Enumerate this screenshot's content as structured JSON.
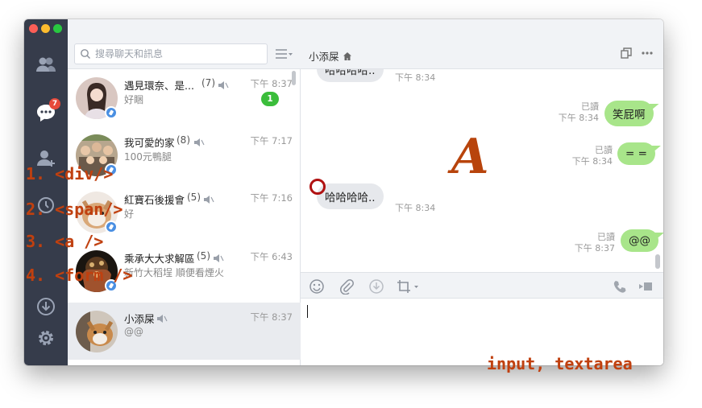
{
  "sidebar": {
    "icons": [
      "friends-icon",
      "chat-icon",
      "add-friend-icon",
      "timeline-icon",
      "download-icon",
      "settings-icon"
    ],
    "chat_badge": "7"
  },
  "search": {
    "placeholder": "搜尋聊天和訊息"
  },
  "chat_list": [
    {
      "name": "遇見環奈、是...",
      "count": "(7)",
      "time": "下午 8:37",
      "preview": "好睏",
      "unread": "1",
      "pinned": true
    },
    {
      "name": "我可愛的家",
      "count": "(8)",
      "time": "下午 7:17",
      "preview": "100元鴨腿",
      "pinned": true
    },
    {
      "name": "紅寶石後援會",
      "count": "(5)",
      "time": "下午 7:16",
      "preview": "好",
      "pinned": true
    },
    {
      "name": "乘承大大求解區",
      "count": "(5)",
      "time": "下午 6:43",
      "preview": "新竹大稻埕 順便看煙火",
      "pinned": true
    },
    {
      "name": "小添屎",
      "count": "",
      "time": "下午 8:37",
      "preview": "@@",
      "pinned": false
    }
  ],
  "chat": {
    "title": "小添屎",
    "messages": [
      {
        "dir": "in",
        "text": "哈哈哈哈..",
        "time": "下午 8:34"
      },
      {
        "dir": "out",
        "text": "笑屁啊",
        "read": "已讀",
        "time": "下午 8:34"
      },
      {
        "dir": "out",
        "text": "= =",
        "read": "已讀",
        "time": "下午 8:34"
      },
      {
        "dir": "in",
        "text": "哈哈哈哈..",
        "time": "下午 8:34"
      },
      {
        "dir": "out",
        "text": "@@",
        "read": "已讀",
        "time": "下午 8:37"
      }
    ]
  },
  "annotations": {
    "list": [
      "1. <div/>",
      "2. <span/>",
      "3. <a />",
      "4. <form />"
    ],
    "big_letter": "A",
    "input_label": "input, textarea"
  },
  "colors": {
    "rail": "#363c4b",
    "out_bubble": "#a8e58a",
    "in_bubble": "#e6e8ec",
    "unread": "#3bbd3b",
    "annotation": "#c0400f"
  }
}
